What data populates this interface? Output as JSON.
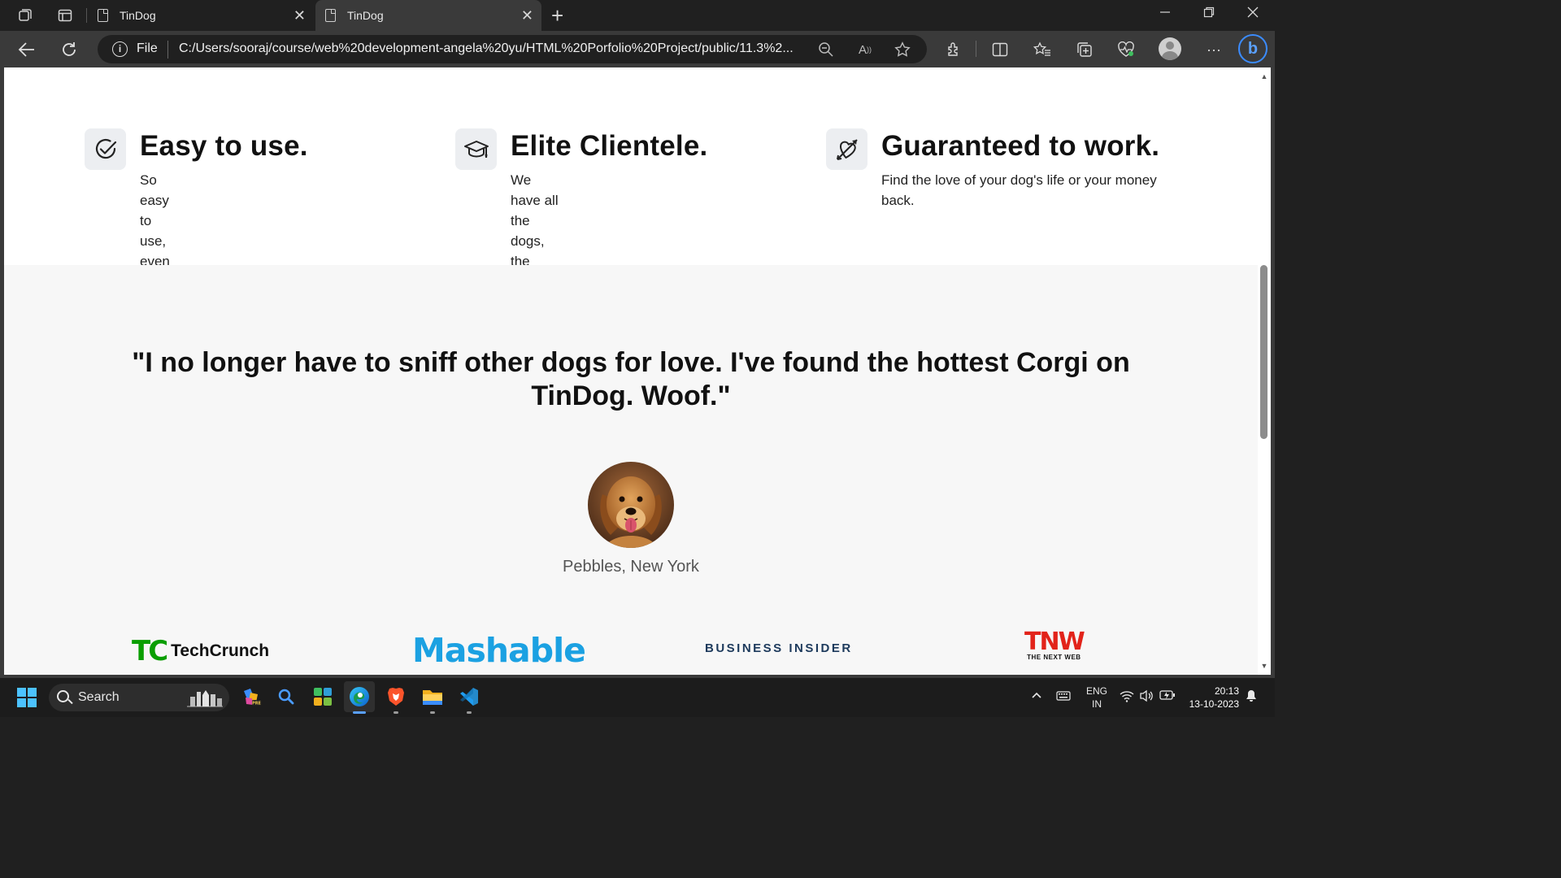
{
  "browser": {
    "tabs": [
      {
        "title": "TinDog",
        "active": false
      },
      {
        "title": "TinDog",
        "active": true
      }
    ],
    "address": {
      "scheme_label": "File",
      "url": "C:/Users/sooraj/course/web%20development-angela%20yu/HTML%20Porfolio%20Project/public/11.3%2..."
    },
    "colors": {
      "chrome_dark": "#202020",
      "chrome_mid": "#3a3a3a",
      "accent": "#3b8cff"
    }
  },
  "page": {
    "features": [
      {
        "icon": "check-circle-icon",
        "title": "Easy to use.",
        "description": "So easy to use, even your dog could do it."
      },
      {
        "icon": "graduation-cap-icon",
        "title": "Elite Clientele.",
        "description": "We have all the dogs, the greatest dogs."
      },
      {
        "icon": "heart-arrow-icon",
        "title": "Guaranteed to work.",
        "description": "Find the love of your dog's life or your money back."
      }
    ],
    "testimonial": {
      "quote": "\"I no longer have to sniff other dogs for love. I've found the hottest Corgi on TinDog. Woof.\"",
      "author": "Pebbles, New York",
      "avatar": "golden-retriever-photo"
    },
    "press_logos": {
      "techcrunch": {
        "mark": "TC",
        "name_a": "Tech",
        "name_b": "Crunch"
      },
      "mashable": "Mashable",
      "business_insider": "BUSINESS INSIDER",
      "tnw": {
        "mark": "TNW",
        "subtitle": "THE NEXT WEB"
      }
    },
    "colors": {
      "techcrunch": "#0a9e01",
      "mashable": "#1ba1e2",
      "business_insider": "#1d3a5c",
      "tnw": "#e2231a"
    }
  },
  "taskbar": {
    "search_label": "Search",
    "language": {
      "line1": "ENG",
      "line2": "IN"
    },
    "time": "20:13",
    "date": "13-10-2023"
  }
}
